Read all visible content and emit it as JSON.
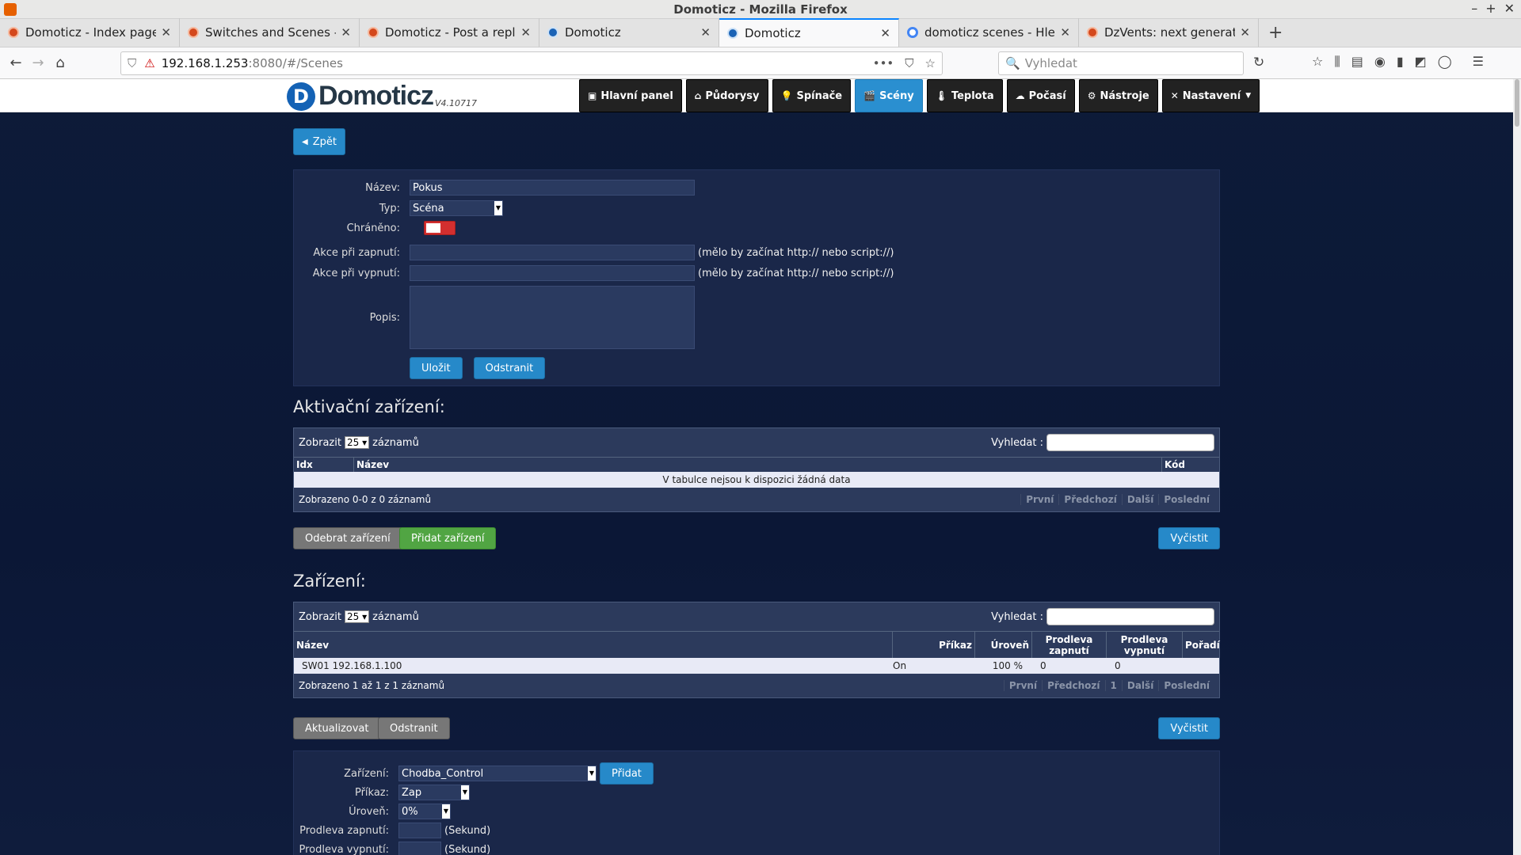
{
  "window": {
    "title": "Domoticz - Mozilla Firefox"
  },
  "tabs": [
    {
      "label": "Domoticz - Index page",
      "icon": "firefox-favicon"
    },
    {
      "label": "Switches and Scenes - D",
      "icon": "firefox-favicon"
    },
    {
      "label": "Domoticz - Post a reply",
      "icon": "firefox-favicon"
    },
    {
      "label": "Domoticz",
      "icon": "domoticz-favicon"
    },
    {
      "label": "Domoticz",
      "icon": "domoticz-favicon"
    },
    {
      "label": "domoticz scenes - Hleda",
      "icon": "google-favicon"
    },
    {
      "label": "DzVents: next generatio",
      "icon": "firefox-favicon"
    }
  ],
  "url": {
    "host": "192.168.1.253",
    "path": ":8080/#/Scenes"
  },
  "search": {
    "placeholder": "Vyhledat"
  },
  "app": {
    "logo": "Domoticz",
    "version": "V4.10717"
  },
  "nav": [
    {
      "label": "Hlavní panel",
      "icon": "▣"
    },
    {
      "label": "Půdorysy",
      "icon": "⌂"
    },
    {
      "label": "Spínače",
      "icon": "💡"
    },
    {
      "label": "Scény",
      "icon": "🎬"
    },
    {
      "label": "Teplota",
      "icon": "🌡"
    },
    {
      "label": "Počasí",
      "icon": "☁"
    },
    {
      "label": "Nástroje",
      "icon": "⚙"
    },
    {
      "label": "Nastavení",
      "icon": "✕"
    }
  ],
  "back": "Zpět",
  "form": {
    "name_label": "Název:",
    "name_value": "Pokus",
    "type_label": "Typ:",
    "type_value": "Scéna",
    "protected_label": "Chráněno:",
    "on_action_label": "Akce při zapnutí:",
    "on_action_hint": "(mělo by začínat http:// nebo script://)",
    "off_action_label": "Akce při vypnutí:",
    "off_action_hint": "(mělo by začínat http:// nebo script://)",
    "desc_label": "Popis:",
    "save": "Uložit",
    "delete": "Odstranit"
  },
  "activation": {
    "title": "Aktivační zařízení:",
    "show": "Zobrazit",
    "per_page": "25",
    "records": "záznamů",
    "search_label": "Vyhledat :",
    "columns": [
      "Idx",
      "Název",
      "Kód"
    ],
    "empty": "V tabulce nejsou k dispozici žádná data",
    "info": "Zobrazeno 0-0 z 0 záznamů",
    "pager": [
      "První",
      "Předchozí",
      "Další",
      "Poslední"
    ],
    "remove": "Odebrat zařízení",
    "add": "Přidat zařízení",
    "clear": "Vyčistit"
  },
  "devices": {
    "title": "Zařízení:",
    "show": "Zobrazit",
    "per_page": "25",
    "records": "záznamů",
    "search_label": "Vyhledat :",
    "columns": [
      "Název",
      "Příkaz",
      "Úroveň",
      "Prodleva zapnutí",
      "Prodleva vypnutí",
      "Pořadí"
    ],
    "rows": [
      {
        "name": "SW01 192.168.1.100",
        "cmd": "On",
        "level": "100 %",
        "on_delay": "0",
        "off_delay": "0",
        "order": ""
      }
    ],
    "info": "Zobrazeno 1 až 1 z 1 záznamů",
    "pager": [
      "První",
      "Předchozí",
      "1",
      "Další",
      "Poslední"
    ],
    "update": "Aktualizovat",
    "delete": "Odstranit",
    "clear": "Vyčistit"
  },
  "addform": {
    "device_label": "Zařízení:",
    "device_value": "Chodba_Control",
    "add": "Přidat",
    "cmd_label": "Příkaz:",
    "cmd_value": "Zap",
    "level_label": "Úroveň:",
    "level_value": "0%",
    "ondelay_label": "Prodleva zapnutí:",
    "ondelay_unit": "(Sekund)",
    "offdelay_label": "Prodleva vypnutí:",
    "offdelay_unit": "(Sekund)"
  }
}
